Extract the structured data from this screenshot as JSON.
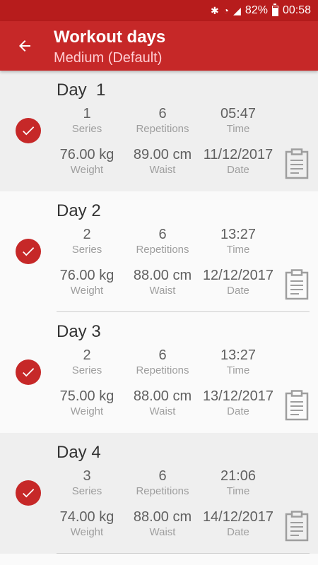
{
  "status_bar": {
    "battery": "82%",
    "time": "00:58"
  },
  "app_bar": {
    "title": "Workout days",
    "subtitle": "Medium (Default)"
  },
  "labels": {
    "series": "Series",
    "repetitions": "Repetitions",
    "time": "Time",
    "weight": "Weight",
    "waist": "Waist",
    "date": "Date"
  },
  "days": [
    {
      "title": "Day  1",
      "series": "1",
      "repetitions": "6",
      "time": "05:47",
      "weight": "76.00 kg",
      "waist": "89.00 cm",
      "date": "11/12/2017",
      "completed": true
    },
    {
      "title": "Day 2",
      "series": "2",
      "repetitions": "6",
      "time": "13:27",
      "weight": "76.00 kg",
      "waist": "88.00 cm",
      "date": "12/12/2017",
      "completed": true
    },
    {
      "title": "Day 3",
      "series": "2",
      "repetitions": "6",
      "time": "13:27",
      "weight": "75.00 kg",
      "waist": "88.00 cm",
      "date": "13/12/2017",
      "completed": true
    },
    {
      "title": "Day 4",
      "series": "3",
      "repetitions": "6",
      "time": "21:06",
      "weight": "74.00 kg",
      "waist": "88.00 cm",
      "date": "14/12/2017",
      "completed": true
    }
  ],
  "colors": {
    "primary": "#c62828",
    "status_bar": "#b71c1c",
    "subtitle": "#ffcdd2"
  }
}
